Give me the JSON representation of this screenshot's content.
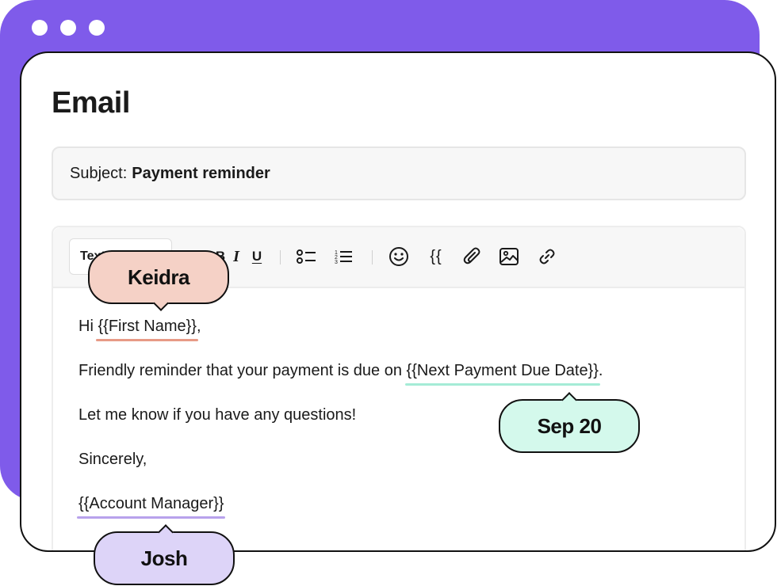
{
  "window": {
    "traffic_dots": [
      "dot",
      "dot",
      "dot"
    ],
    "accent_color": "#7f5bea"
  },
  "email": {
    "title": "Email",
    "subject_label": "Subject:",
    "subject_value": "Payment reminder"
  },
  "toolbar": {
    "style_select_value": "Text",
    "bold_label": "B",
    "italic_label": "I",
    "underline_label": "U",
    "bullet_list_icon": "bullet-list-icon",
    "numbered_list_icon": "numbered-list-icon",
    "emoji_icon": "emoji-icon",
    "variable_label": "{{",
    "attachment_icon": "paperclip-icon",
    "image_icon": "image-icon",
    "link_icon": "link-icon"
  },
  "body": {
    "greeting_prefix": "Hi ",
    "first_name_var": "{{First Name}}",
    "greeting_suffix": ",",
    "reminder_prefix": "Friendly reminder that your payment is due on ",
    "due_date_var": "{{Next Payment Due Date}}",
    "reminder_suffix": ".",
    "questions_line": "Let me know if you have any questions!",
    "closing": "Sincerely,",
    "manager_var": "{{Account Manager}}"
  },
  "previews": {
    "first_name": "Keidra",
    "due_date": "Sep 20",
    "account_manager": "Josh"
  },
  "colors": {
    "first_name_underline": "#e79a86",
    "due_date_underline": "#a5ecd6",
    "manager_underline": "#b8a2ec",
    "first_name_bubble": "#f5d1c6",
    "due_date_bubble": "#d4f9ec",
    "manager_bubble": "#ddd4f8"
  }
}
